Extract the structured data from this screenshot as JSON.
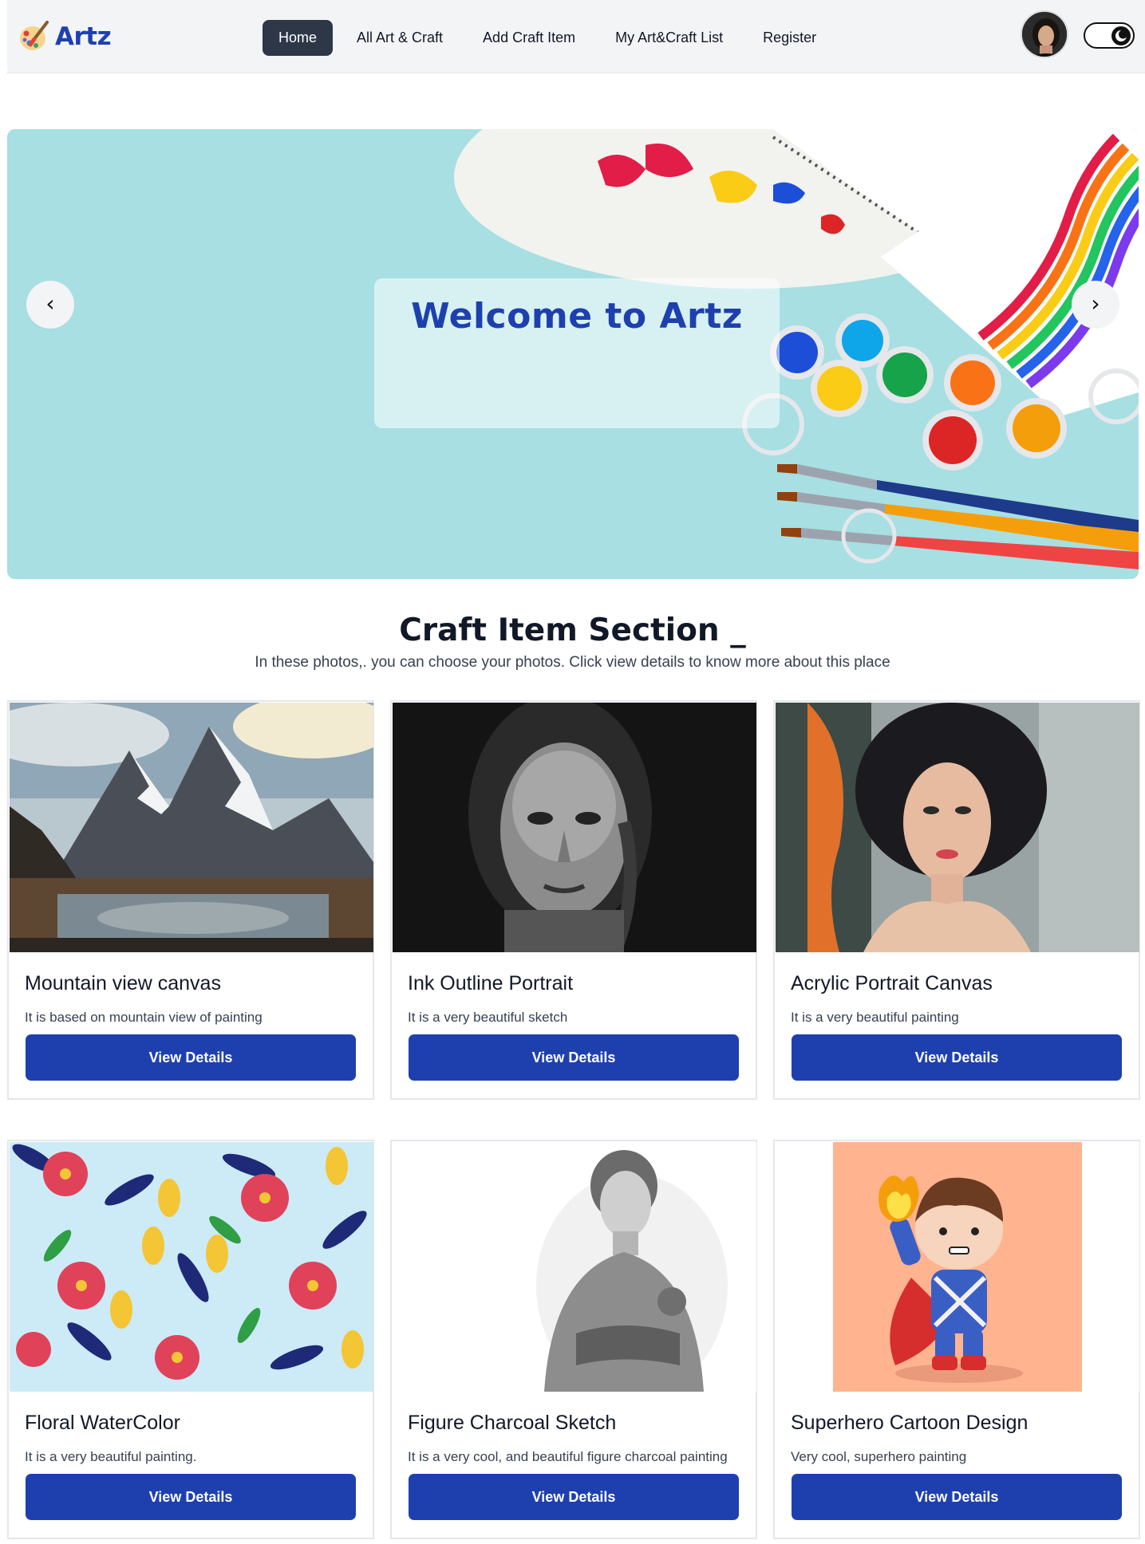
{
  "brand": {
    "name": "Artz"
  },
  "nav": {
    "items": [
      {
        "label": "Home",
        "active": true
      },
      {
        "label": "All Art & Craft",
        "active": false
      },
      {
        "label": "Add Craft Item",
        "active": false
      },
      {
        "label": "My Art&Craft List",
        "active": false
      },
      {
        "label": "Register",
        "active": false
      }
    ]
  },
  "hero": {
    "title": "Welcome to Artz",
    "prev_icon": "chevron-left-icon",
    "next_icon": "chevron-right-icon",
    "prev_glyph": "‹",
    "next_glyph": "›"
  },
  "section": {
    "title": "Craft Item Section _",
    "subtitle": "In these photos,. you can choose your photos. Click view details to know more about this place"
  },
  "cards": [
    {
      "title": "Mountain view canvas",
      "description": "It is based on mountain view of painting",
      "button": "View Details"
    },
    {
      "title": "Ink Outline Portrait",
      "description": "It is a very beautiful sketch",
      "button": "View Details"
    },
    {
      "title": "Acrylic Portrait Canvas",
      "description": "It is a very beautiful painting",
      "button": "View Details"
    },
    {
      "title": "Floral WaterColor",
      "description": "It is a very beautiful painting.",
      "button": "View Details"
    },
    {
      "title": "Figure Charcoal Sketch",
      "description": "It is a very cool, and beautiful figure charcoal painting",
      "button": "View Details"
    },
    {
      "title": "Superhero Cartoon Design",
      "description": "Very cool, superhero painting",
      "button": "View Details"
    }
  ],
  "colors": {
    "accent": "#1e40af",
    "nav_active": "#2d3748",
    "hero_bg": "#a5dde0"
  }
}
